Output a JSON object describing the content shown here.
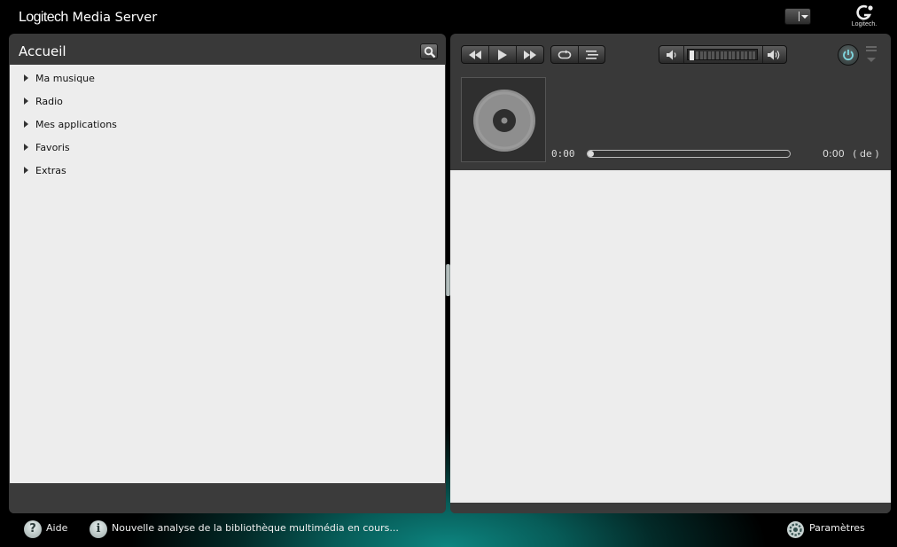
{
  "header": {
    "brand_logitech": "Logitech",
    "brand_product": "Media Server",
    "logo_text": "Logitech."
  },
  "browser": {
    "title": "Accueil",
    "menu": [
      {
        "label": "Ma musique"
      },
      {
        "label": "Radio"
      },
      {
        "label": "Mes applications"
      },
      {
        "label": "Favoris"
      },
      {
        "label": "Extras"
      }
    ]
  },
  "player": {
    "elapsed": "0:00",
    "total": "0:00",
    "of_label": "( de )",
    "progress": 0,
    "volume": 0
  },
  "footer": {
    "help_label": "Aide",
    "status": "Nouvelle analyse de la bibliothèque multimédia en cours...",
    "settings_label": "Paramètres"
  },
  "colors": {
    "accent_teal": "#0d8580",
    "panel": "#393939",
    "content_bg": "#ededed"
  }
}
